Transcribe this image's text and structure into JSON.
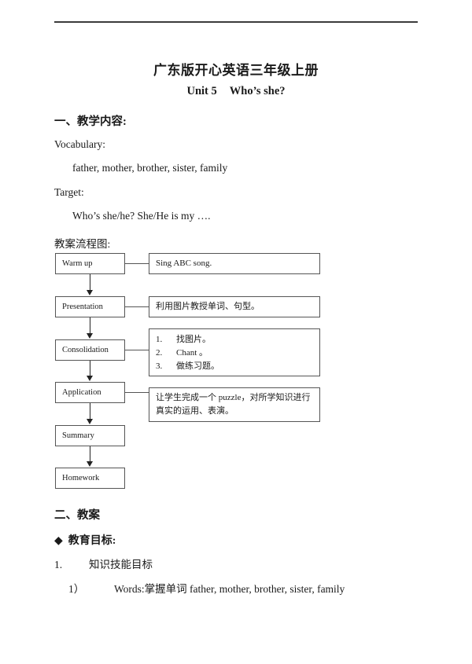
{
  "document": {
    "title": "广东版开心英语三年级上册",
    "subtitle_left": "Unit 5",
    "subtitle_right": "Who’s she?"
  },
  "sections": {
    "teaching_content_heading": "一、教学内容:",
    "vocabulary_label": "Vocabulary:",
    "vocabulary_words": "father, mother, brother, sister, family",
    "target_label": "Target:",
    "target_sentence": "Who’s she/he?   She/He is my ….",
    "flowchart_label": "教案流程图:",
    "lesson_plan_heading": "二、教案",
    "education_goal_label": "教育目标:",
    "education_goal_bullet": "◆",
    "item_1_number": "1.",
    "item_1_text": "知识技能目标",
    "item_1a_number": "1）",
    "item_1a_text": "Words:掌握单词 father, mother, brother, sister, family"
  },
  "flowchart": {
    "steps": [
      {
        "label": "Warm up",
        "detail_type": "text",
        "detail": "Sing ABC song."
      },
      {
        "label": "Presentation",
        "detail_type": "text",
        "detail": "利用图片教授单词、句型。"
      },
      {
        "label": "Consolidation",
        "detail_type": "list",
        "detail_items": [
          {
            "num": "1.",
            "text": "找图片。"
          },
          {
            "num": "2.",
            "text": "Chant 。"
          },
          {
            "num": "3.",
            "text": "做练习题。"
          }
        ]
      },
      {
        "label": "Application",
        "detail_type": "text",
        "detail": "让学生完成一个 puzzle，对所学知识进行真实的运用、表演。"
      },
      {
        "label": "Summary",
        "detail_type": "none"
      },
      {
        "label": "Homework",
        "detail_type": "none"
      }
    ]
  },
  "colors": {
    "text": "#1a1a1a",
    "rule": "#3b3b3b",
    "box_border": "#555555",
    "arrow": "#222222",
    "page_background": "#ffffff"
  }
}
